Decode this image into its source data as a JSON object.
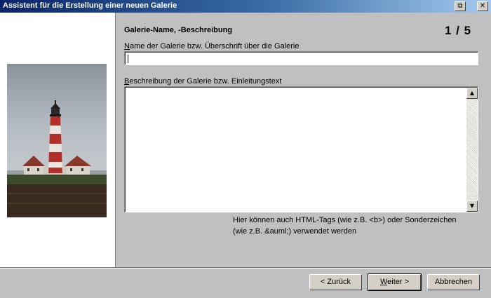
{
  "window": {
    "title": "Assistent für die Erstellung einer neuen Galerie",
    "restore_glyph": "⧉",
    "close_glyph": "✕"
  },
  "step": {
    "heading": "Galerie-Name, -Beschreibung",
    "counter": "1 / 5"
  },
  "form": {
    "name_label_access": "N",
    "name_label_rest": "ame der Galerie bzw. Überschrift über die Galerie",
    "name_value": "",
    "description_label_access": "B",
    "description_label_rest": "eschreibung der Galerie bzw. Einleitungstext",
    "description_value": "",
    "hint_line1": "Hier können auch HTML-Tags (wie z.B. <b>) oder Sonderzeichen",
    "hint_line2": "(wie z.B. &auml;) verwendet werden"
  },
  "buttons": {
    "back": "< Zurück",
    "next_access": "W",
    "next_rest": "eiter >",
    "cancel": "Abbrechen"
  },
  "icons": {
    "scroll_up": "▲",
    "scroll_down": "▼"
  }
}
